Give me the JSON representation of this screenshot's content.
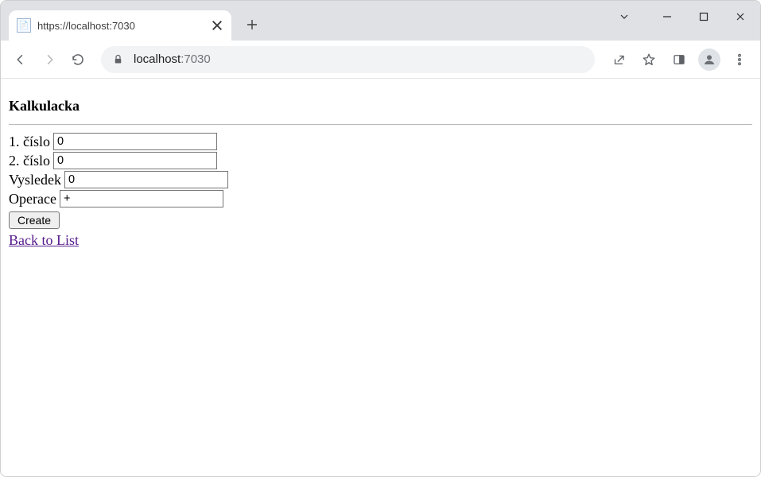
{
  "browser": {
    "tab_title": "https://localhost:7030",
    "url_host_dark": "localhost",
    "url_host_light": ":7030"
  },
  "page": {
    "heading": "Kalkulacka",
    "labels": {
      "cislo1": "1. číslo",
      "cislo2": "2. číslo",
      "vysledek": "Vysledek",
      "operace": "Operace"
    },
    "values": {
      "cislo1": "0",
      "cislo2": "0",
      "vysledek": "0",
      "operace": "+"
    },
    "create_button": "Create",
    "back_link": "Back to List"
  }
}
